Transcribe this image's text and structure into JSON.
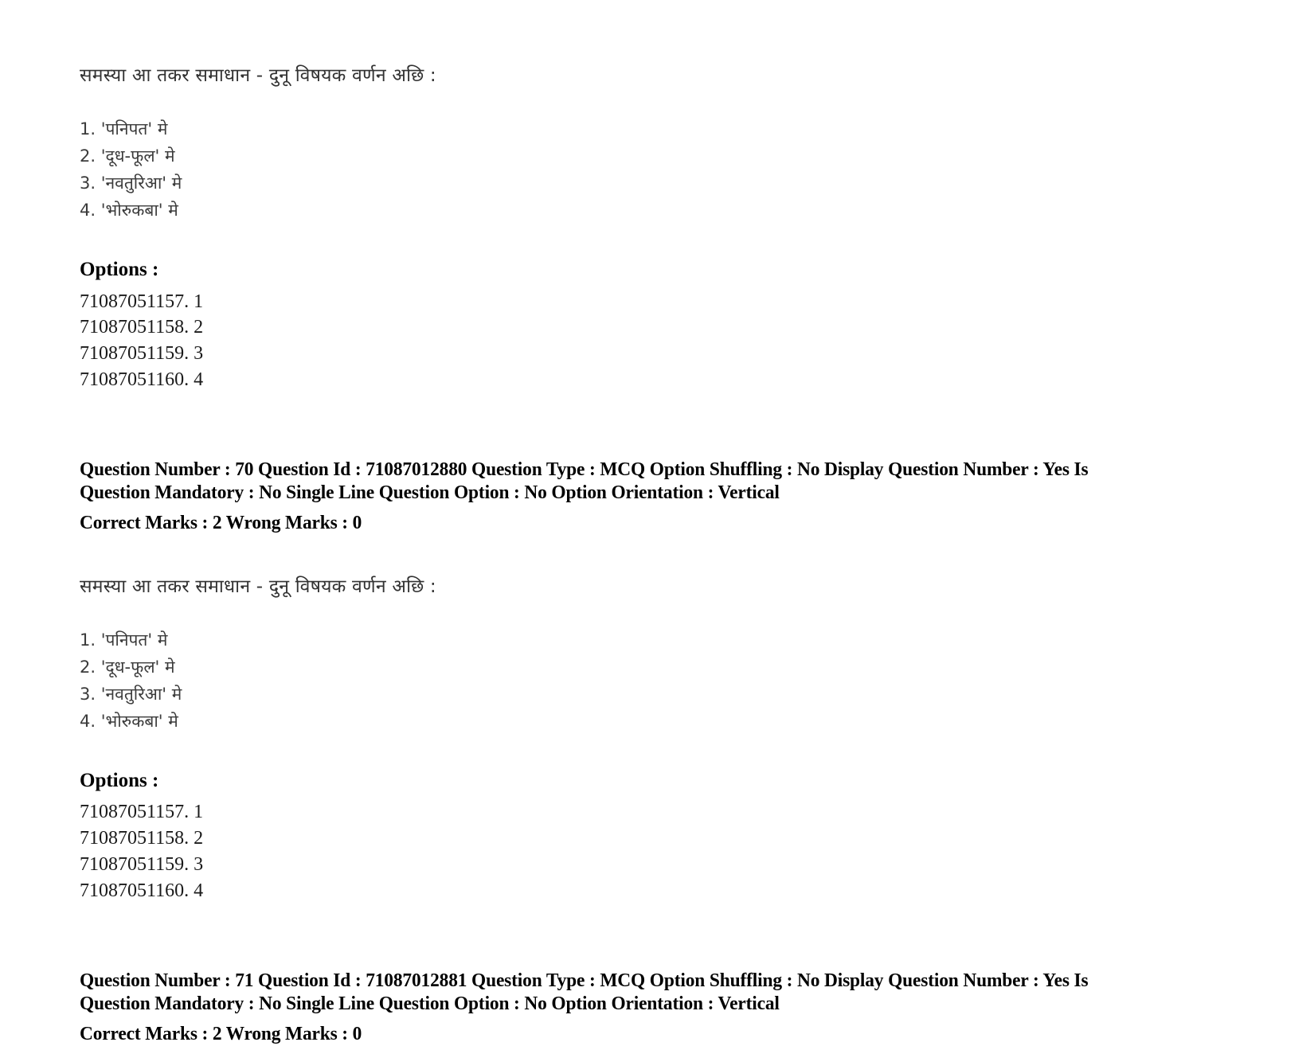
{
  "document": {
    "type": "exam-question-paper-scan",
    "language_script": "Devanagari (Maithili)"
  },
  "questions": [
    {
      "passage_heading": "समस्या आ तकर समाधान - दुनू विषयक वर्णन अछि :",
      "statements": [
        "1. 'पनिपत' मे",
        "2. 'दूध-फूल' मे",
        "3. 'नवतुरिआ' मे",
        "4. 'भोरुकबा' मे"
      ],
      "options_label": "Options :",
      "options": [
        {
          "id": "71087051157.",
          "value": "1"
        },
        {
          "id": "71087051158.",
          "value": "2"
        },
        {
          "id": "71087051159.",
          "value": "3"
        },
        {
          "id": "71087051160.",
          "value": "4"
        }
      ],
      "meta": {
        "line1": "Question Number : 70 Question Id : 71087012880 Question Type : MCQ Option Shuffling : No Display Question Number : Yes Is Question Mandatory : No Single Line Question Option : No Option Orientation : Vertical",
        "line2": "Correct Marks : 2 Wrong Marks : 0"
      }
    },
    {
      "passage_heading": "समस्या आ तकर समाधान - दुनू विषयक वर्णन अछि :",
      "statements": [
        "1. 'पनिपत' मे",
        "2. 'दूध-फूल' मे",
        "3. 'नवतुरिआ' मे",
        "4. 'भोरुकबा' मे"
      ],
      "options_label": "Options :",
      "options": [
        {
          "id": "71087051157.",
          "value": "1"
        },
        {
          "id": "71087051158.",
          "value": "2"
        },
        {
          "id": "71087051159.",
          "value": "3"
        },
        {
          "id": "71087051160.",
          "value": "4"
        }
      ],
      "meta": {
        "line1": "Question Number : 71 Question Id : 71087012881 Question Type : MCQ Option Shuffling : No Display Question Number : Yes Is Question Mandatory : No Single Line Question Option : No Option Orientation : Vertical",
        "line2": "Correct Marks : 2 Wrong Marks : 0"
      }
    }
  ]
}
